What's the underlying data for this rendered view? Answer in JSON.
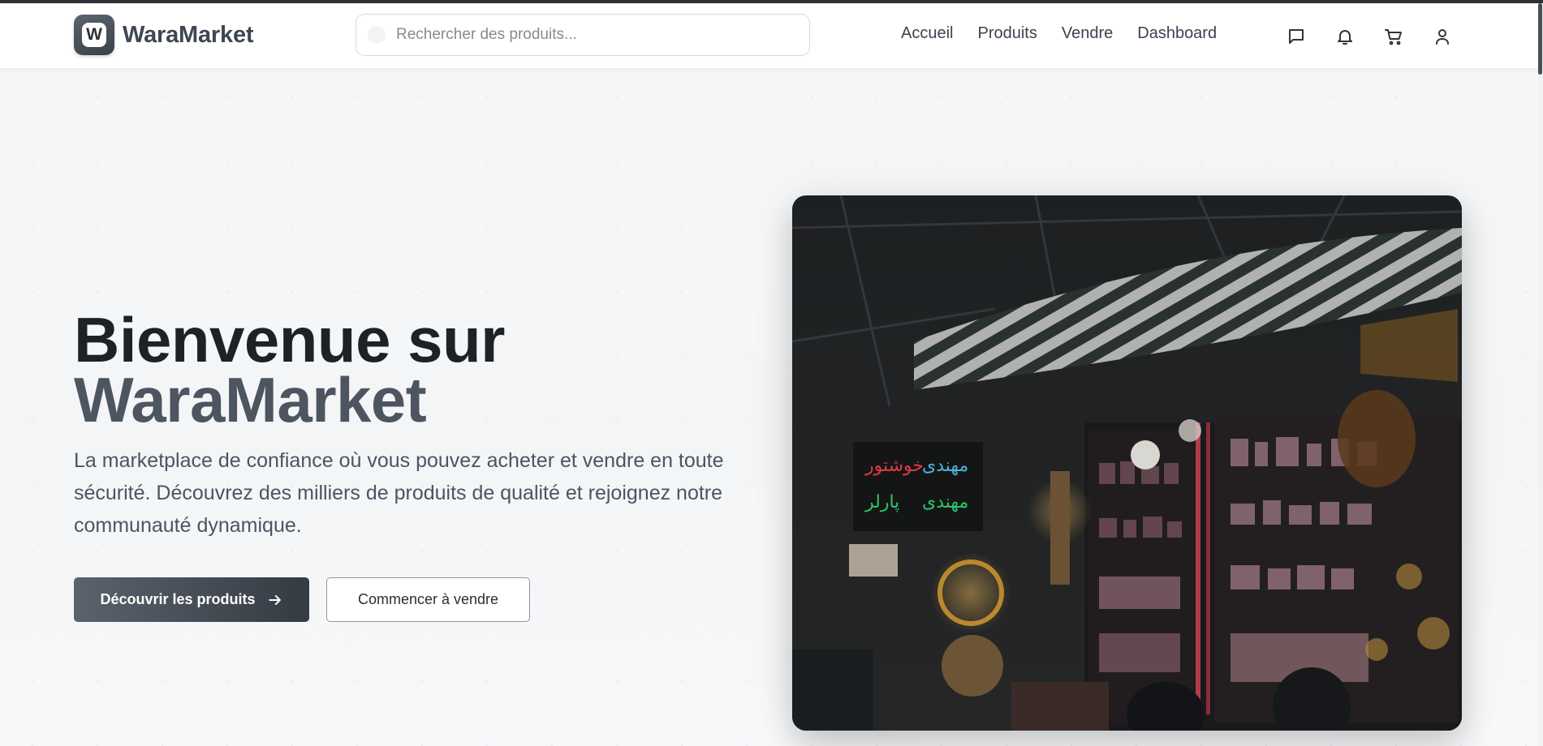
{
  "brand": {
    "logo_letter": "W",
    "name": "WaraMarket"
  },
  "search": {
    "placeholder": "Rechercher des produits..."
  },
  "nav": {
    "items": [
      "Accueil",
      "Produits",
      "Vendre",
      "Dashboard"
    ]
  },
  "header_icons": [
    "message-icon",
    "bell-icon",
    "cart-icon",
    "user-icon"
  ],
  "hero": {
    "title_line1": "Bienvenue sur",
    "title_line2": "WaraMarket",
    "description": "La marketplace de confiance où vous pouvez acheter et vendre en toute sécurité. Découvrez des milliers de produits de qualité et rejoignez notre communauté dynamique.",
    "primary_button": "Découvrir les produits",
    "secondary_button": "Commencer à vendre",
    "image_icon": "market-photo"
  },
  "colors": {
    "accent_dark": "#353b43",
    "text_primary": "#1e2227",
    "text_secondary": "#4b5563"
  }
}
